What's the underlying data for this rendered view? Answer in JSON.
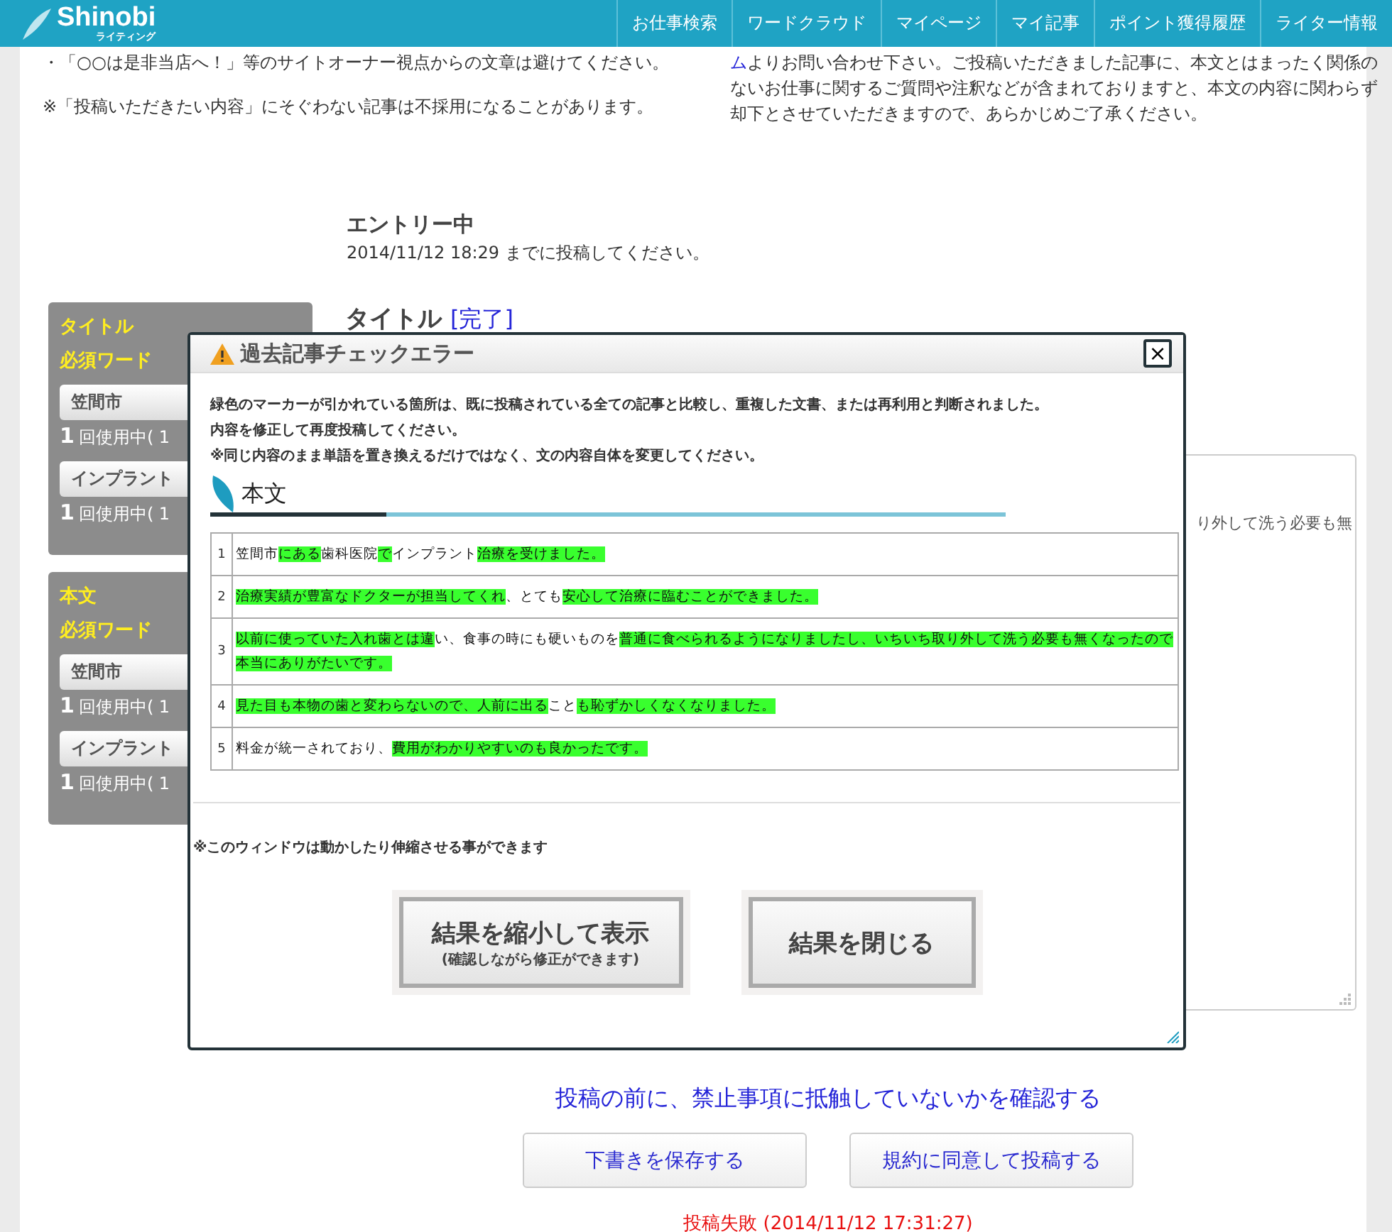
{
  "header": {
    "logo": "Shinobi",
    "logo_sub": "ライティング",
    "nav": [
      "お仕事検索",
      "ワードクラウド",
      "マイページ",
      "マイ記事",
      "ポイント獲得履歴",
      "ライター情報"
    ]
  },
  "notes_left": [
    "・「○○は是非当店へ！」等のサイトオーナー視点からの文章は避けてください。",
    "※「投稿いただきたい内容」にそぐわない記事は不採用になることがあります。"
  ],
  "notes_right": {
    "link": "ム",
    "text": "よりお問い合わせ下さい。ご投稿いただきました記事に、本文とはまったく関係のないお仕事に関するご質問や注釈などが含まれておりますと、本文の内容に関わらず却下とさせていただきますので、あらかじめご了承ください。"
  },
  "entry": {
    "status": "エントリー中",
    "deadline": "2014/11/12 18:29 までに投稿してください。"
  },
  "sidebar": [
    {
      "heading": "タイトル",
      "subheading": "必須ワード",
      "words": [
        {
          "word": "笠間市",
          "count": "1",
          "usage": "回使用中( 1"
        },
        {
          "word": "インプラント",
          "count": "1",
          "usage": "回使用中( 1"
        }
      ]
    },
    {
      "heading": "本文",
      "subheading": "必須ワード",
      "words": [
        {
          "word": "笠間市",
          "count": "1",
          "usage": "回使用中( 1"
        },
        {
          "word": "インプラント",
          "count": "1",
          "usage": "回使用中( 1"
        }
      ]
    }
  ],
  "title_field": {
    "label": "タイトル",
    "status": "[完了]"
  },
  "body_field": {
    "value": "り外して洗う必要も無"
  },
  "dialog": {
    "title": "過去記事チェックエラー",
    "close": "×",
    "messages": [
      "緑色のマーカーが引かれている箇所は、既に投稿されている全ての記事と比較し、重複した文書、または再利用と判断されました。",
      "内容を修正して再度投稿してください。",
      "※同じ内容のまま単語を置き換えるだけではなく、文の内容自体を変更してください。"
    ],
    "section": "本文",
    "rows": [
      {
        "number": "1",
        "segments": [
          {
            "text": "笠間市",
            "marked": false
          },
          {
            "text": "にある",
            "marked": true
          },
          {
            "text": "歯科医院",
            "marked": false
          },
          {
            "text": "で",
            "marked": true
          },
          {
            "text": "インプラント",
            "marked": false
          },
          {
            "text": "治療を受けました。",
            "marked": true
          }
        ]
      },
      {
        "number": "2",
        "segments": [
          {
            "text": "治療実績が豊富なドクターが担当してくれ",
            "marked": true
          },
          {
            "text": "、とても",
            "marked": false
          },
          {
            "text": "安心して治療に臨むことができました。",
            "marked": true
          }
        ]
      },
      {
        "number": "3",
        "segments": [
          {
            "text": "以前に使っていた入れ歯とは違",
            "marked": true
          },
          {
            "text": "い、食事の時にも硬いものを",
            "marked": false
          },
          {
            "text": "普通に食べられるようになりましたし、いちいち取り外して洗う必要も無くなったので本当にありがたいです。",
            "marked": true
          }
        ]
      },
      {
        "number": "4",
        "segments": [
          {
            "text": "見た目も本物の歯と変わらないので、人前に出る",
            "marked": true
          },
          {
            "text": "こと",
            "marked": false
          },
          {
            "text": "も恥ずかしくなくなりました。",
            "marked": true
          }
        ]
      },
      {
        "number": "5",
        "segments": [
          {
            "text": "料金が統一されており、",
            "marked": false
          },
          {
            "text": "費用がわかりやすいのも良かったです。",
            "marked": true
          }
        ]
      }
    ],
    "note": "※このウィンドウは動かしたり伸縮させる事ができます",
    "buttons": [
      {
        "label": "結果を縮小して表示",
        "sublabel": "(確認しながら修正ができます)"
      },
      {
        "label": "結果を閉じる"
      }
    ]
  },
  "footer": {
    "check_link": "投稿の前に、禁止事項に抵触していないかを確認する",
    "buttons": [
      "下書きを保存する",
      "規約に同意して投稿する"
    ],
    "status": "投稿失敗 (2014/11/12 17:31:27)"
  }
}
